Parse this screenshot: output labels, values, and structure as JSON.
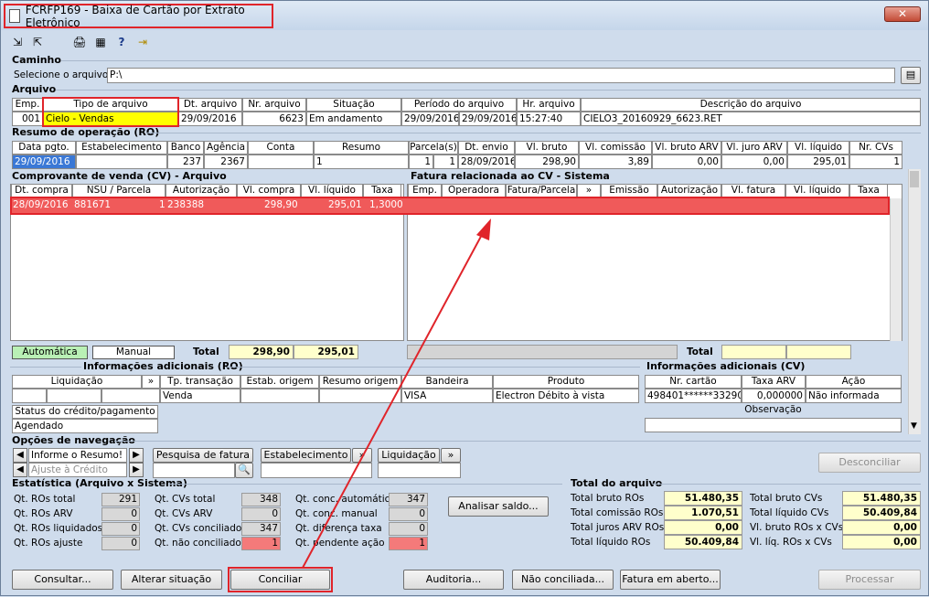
{
  "window": {
    "title": "FCRFP169 - Baixa de Cartão por Extrato Eletrônico",
    "close": "✕"
  },
  "toolbar": [
    "⇲",
    "⇱",
    "🖨",
    "▦",
    "?",
    "⇥"
  ],
  "caminho": {
    "section": "Caminho",
    "label": "Selecione o arquivo",
    "value": "P:\\"
  },
  "arquivo": {
    "section": "Arquivo",
    "headers": [
      "Emp.",
      "Tipo de arquivo",
      "Dt. arquivo",
      "Nr. arquivo",
      "Situação",
      "Período do arquivo",
      "Hr. arquivo",
      "Descrição do arquivo"
    ],
    "row": {
      "emp": "001",
      "tipo": "Cielo - Vendas",
      "dt": "29/09/2016",
      "nr": "6623",
      "situacao": "Em andamento",
      "periodo_ini": "29/09/2016",
      "periodo_fim": "29/09/2016",
      "hr": "15:27:40",
      "descricao": "CIELO3_20160929_6623.RET"
    }
  },
  "ro": {
    "section": "Resumo de operação (RO)",
    "headers": [
      "Data pgto.",
      "Estabelecimento",
      "Banco",
      "Agência",
      "Conta",
      "Resumo",
      "Parcela(s)",
      "Dt. envio",
      "Vl. bruto",
      "Vl. comissão",
      "Vl. bruto ARV",
      "Vl. juro ARV",
      "Vl. líquido",
      "Nr. CVs"
    ],
    "row": {
      "data": "29/09/2016",
      "banco": "237",
      "agencia": "2367",
      "resumo": "1",
      "parcela_a": "1",
      "parcela_b": "1",
      "envio": "28/09/2016",
      "bruto": "298,90",
      "comissao": "3,89",
      "bruto_arv": "0,00",
      "juro_arv": "0,00",
      "liquido": "295,01",
      "ncvs": "1"
    }
  },
  "cv": {
    "section": "Comprovante de venda (CV) - Arquivo",
    "headers": [
      "Dt. compra",
      "NSU / Parcela",
      "Autorização",
      "Vl. compra",
      "Vl. líquido",
      "Taxa"
    ],
    "row": {
      "dt": "28/09/2016",
      "nsu": "881671",
      "parcela": "1",
      "aut": "238388",
      "compra": "298,90",
      "liquido": "295,01",
      "taxa": "1,3000"
    },
    "automatica": "Automática",
    "manual": "Manual",
    "total_label": "Total",
    "total_compra": "298,90",
    "total_liquido": "295,01"
  },
  "fatura": {
    "section": "Fatura relacionada ao CV - Sistema",
    "headers": [
      "Emp.",
      "Operadora",
      "Fatura/Parcela",
      "»",
      "Emissão",
      "Autorização",
      "Vl. fatura",
      "Vl. líquido",
      "Taxa"
    ],
    "total_label": "Total"
  },
  "info_ro": {
    "section": "Informações adicionais (RO)",
    "headers": [
      "Liquidação",
      "»",
      "Tp. transação",
      "Estab. origem",
      "Resumo origem",
      "Bandeira",
      "Produto"
    ],
    "row": {
      "tp": "Venda",
      "bandeira": "VISA",
      "produto": "Electron Débito à vista"
    },
    "status_label": "Status do crédito/pagamento",
    "status_value": "Agendado"
  },
  "info_cv": {
    "section": "Informações adicionais (CV)",
    "headers": [
      "Nr. cartão",
      "Taxa ARV",
      "Ação"
    ],
    "row": {
      "cartao": "498401******3329",
      "taxa": "000",
      "taxa_arv": "0,000000",
      "acao": "Não informada"
    },
    "obs": "Observação"
  },
  "nav": {
    "section": "Opções de navegação",
    "combo1": "Informe o Resumo!",
    "combo2": "Ajuste à Crédito",
    "pesquisa": "Pesquisa de fatura",
    "estab": "Estabelecimento",
    "liquidacao": "Liquidação",
    "desconciliar": "Desconciliar"
  },
  "stats": {
    "section": "Estatística (Arquivo x Sistema)",
    "col1": [
      {
        "l": "Qt. ROs total",
        "v": "291"
      },
      {
        "l": "Qt. ROs ARV",
        "v": "0"
      },
      {
        "l": "Qt. ROs liquidados",
        "v": "0"
      },
      {
        "l": "Qt. ROs ajuste",
        "v": "0"
      }
    ],
    "col2": [
      {
        "l": "Qt. CVs total",
        "v": "348"
      },
      {
        "l": "Qt. CVs ARV",
        "v": "0"
      },
      {
        "l": "Qt. CVs conciliado",
        "v": "347"
      },
      {
        "l": "Qt. não conciliado",
        "v": "1"
      }
    ],
    "col3": [
      {
        "l": "Qt. conc. automático",
        "v": "347"
      },
      {
        "l": "Qt. conc. manual",
        "v": "0"
      },
      {
        "l": "Qt. diferença taxa",
        "v": "0"
      },
      {
        "l": "Qt. pendente ação",
        "v": "1"
      }
    ],
    "analisar": "Analisar saldo..."
  },
  "totais": {
    "section": "Total do arquivo",
    "left": [
      {
        "l": "Total bruto ROs",
        "v": "51.480,35"
      },
      {
        "l": "Total comissão ROs",
        "v": "1.070,51"
      },
      {
        "l": "Total juros ARV ROs",
        "v": "0,00"
      },
      {
        "l": "Total líquido ROs",
        "v": "50.409,84"
      }
    ],
    "right": [
      {
        "l": "Total bruto CVs",
        "v": "51.480,35"
      },
      {
        "l": "Total líquido CVs",
        "v": "50.409,84"
      },
      {
        "l": "Vl. bruto ROs x CVs",
        "v": "0,00"
      },
      {
        "l": "Vl. líq. ROs x CVs",
        "v": "0,00"
      }
    ]
  },
  "buttons": {
    "consultar": "Consultar...",
    "alterar": "Alterar situação",
    "conciliar": "Conciliar",
    "auditoria": "Auditoria...",
    "nao_conciliada": "Não conciliada...",
    "fatura_aberto": "Fatura em aberto...",
    "processar": "Processar"
  }
}
